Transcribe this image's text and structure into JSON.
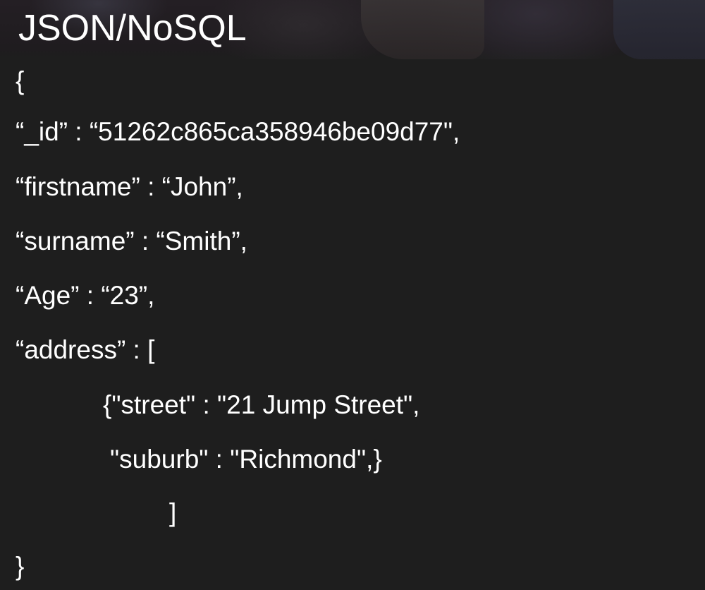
{
  "slide": {
    "title": "JSON/NoSQL",
    "code_lines": [
      "{",
      "“_id” : “51262c865ca358946be09d77\",",
      "“firstname” : “John”,",
      "“surname” : “Smith”,",
      "“Age” : “23”,",
      "“address” : [",
      "{\"street\" : \"21 Jump Street\",",
      "\"suburb\" : \"Richmond\",}",
      "]",
      "}"
    ]
  }
}
